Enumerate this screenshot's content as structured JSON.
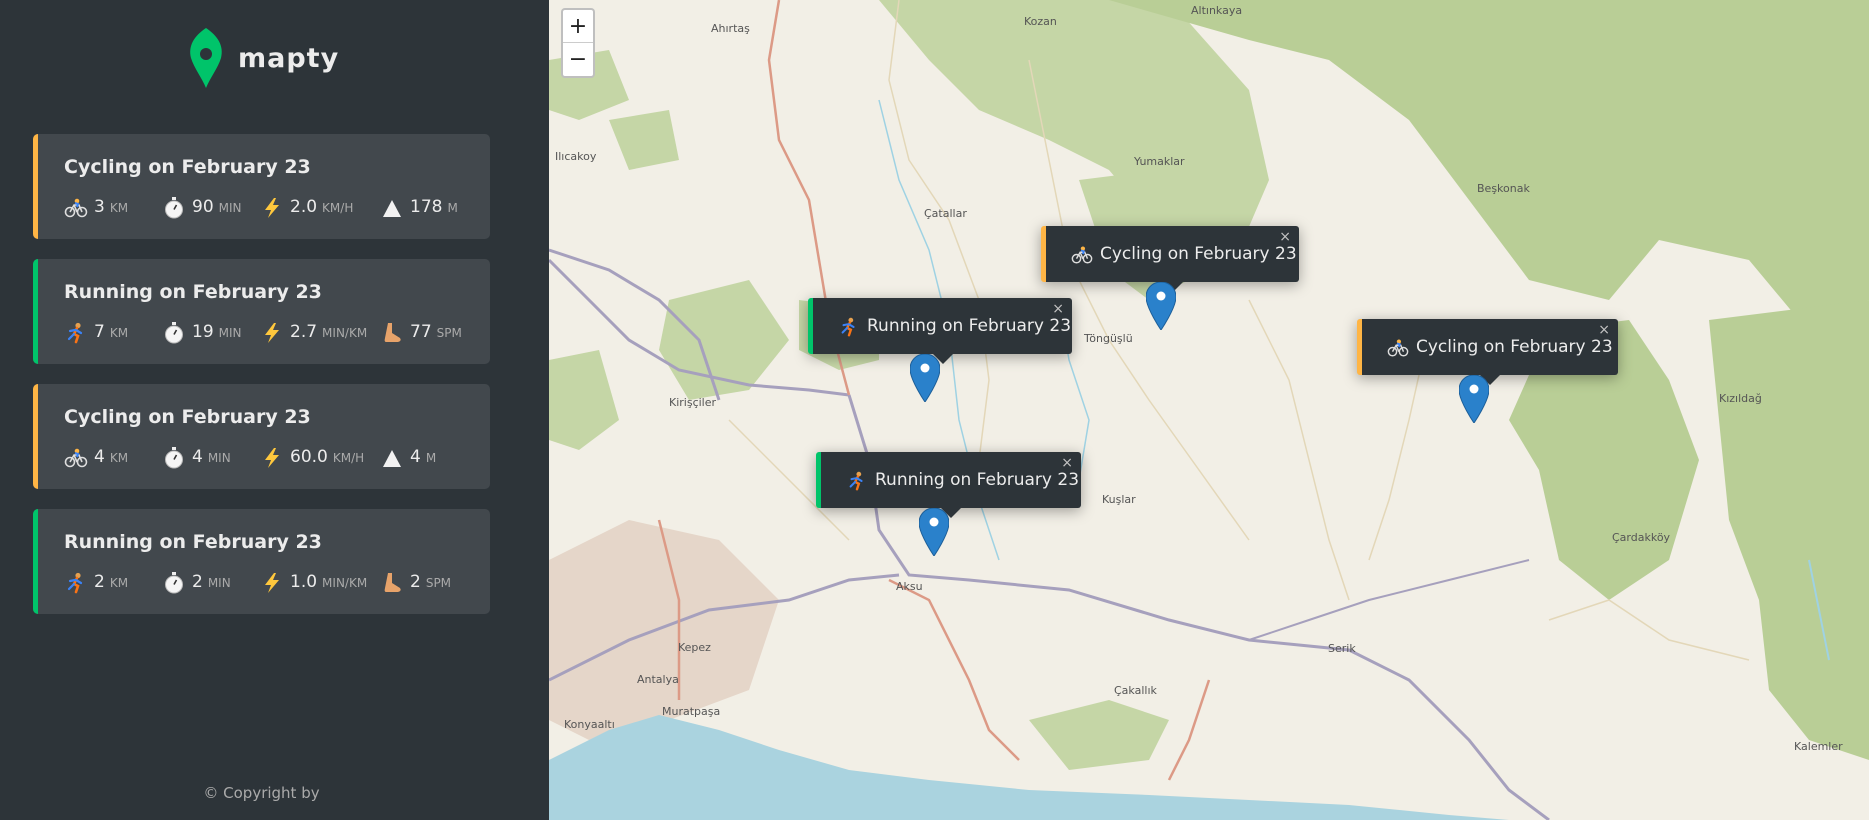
{
  "app": {
    "name": "mapty"
  },
  "workouts": [
    {
      "type": "cycling",
      "title": "Cycling on February 23",
      "details": [
        {
          "icon": "bicycle-icon",
          "value": "3",
          "unit": "km"
        },
        {
          "icon": "stopwatch-icon",
          "value": "90",
          "unit": "min"
        },
        {
          "icon": "lightning-icon",
          "value": "2.0",
          "unit": "km/h"
        },
        {
          "icon": "mountain-icon",
          "value": "178",
          "unit": "m"
        }
      ]
    },
    {
      "type": "running",
      "title": "Running on February 23",
      "details": [
        {
          "icon": "runner-icon",
          "value": "7",
          "unit": "km"
        },
        {
          "icon": "stopwatch-icon",
          "value": "19",
          "unit": "min"
        },
        {
          "icon": "lightning-icon",
          "value": "2.7",
          "unit": "min/km"
        },
        {
          "icon": "foot-icon",
          "value": "77",
          "unit": "spm"
        }
      ]
    },
    {
      "type": "cycling",
      "title": "Cycling on February 23",
      "details": [
        {
          "icon": "bicycle-icon",
          "value": "4",
          "unit": "km"
        },
        {
          "icon": "stopwatch-icon",
          "value": "4",
          "unit": "min"
        },
        {
          "icon": "lightning-icon",
          "value": "60.0",
          "unit": "km/h"
        },
        {
          "icon": "mountain-icon",
          "value": "4",
          "unit": "m"
        }
      ]
    },
    {
      "type": "running",
      "title": "Running on February 23",
      "details": [
        {
          "icon": "runner-icon",
          "value": "2",
          "unit": "km"
        },
        {
          "icon": "stopwatch-icon",
          "value": "2",
          "unit": "min"
        },
        {
          "icon": "lightning-icon",
          "value": "1.0",
          "unit": "min/km"
        },
        {
          "icon": "foot-icon",
          "value": "2",
          "unit": "spm"
        }
      ]
    }
  ],
  "footer": {
    "copyright": "© Copyright by"
  },
  "map": {
    "zoom_in": "+",
    "zoom_out": "−",
    "popups": [
      {
        "type": "cycling",
        "text": "Cycling on February 23",
        "close": "×"
      },
      {
        "type": "running",
        "text": "Running on February 23",
        "close": "×"
      },
      {
        "type": "cycling",
        "text": "Cycling on February 23",
        "close": "×"
      },
      {
        "type": "running",
        "text": "Running on February 23",
        "close": "×"
      }
    ],
    "place_labels": [
      "Altınkaya",
      "Ahırtaş",
      "Kozan",
      "Yumaklar",
      "Beşkonak",
      "Ilıcakoy",
      "Çatallar",
      "Töngüşlü",
      "Kirişçiler",
      "Kızıldağ",
      "Kuşlar",
      "Çardakköy",
      "Aksu",
      "Kepez",
      "Antalya",
      "Muratpaşa",
      "Konyaaltı",
      "Serik",
      "Çakallık",
      "Kalemler"
    ],
    "colors": {
      "cycling": "#ffb545",
      "running": "#00c46a",
      "marker": "#2a81cb"
    }
  }
}
